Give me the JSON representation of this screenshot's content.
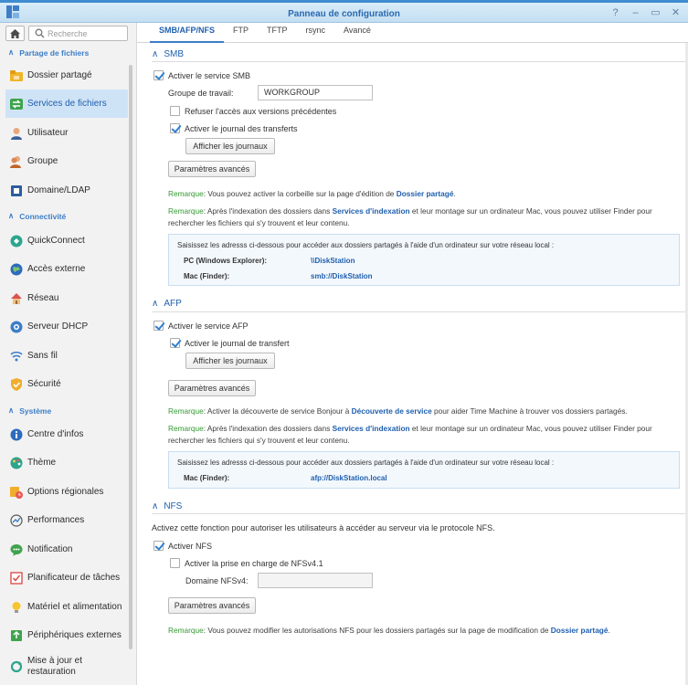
{
  "window": {
    "title": "Panneau de configuration",
    "controls": [
      "?",
      "–",
      "▭",
      "✕"
    ]
  },
  "sidebar": {
    "search_placeholder": "Recherche",
    "sections": [
      {
        "label": "Partage de fichiers"
      },
      {
        "label": "Connectivité"
      },
      {
        "label": "Système"
      }
    ],
    "items": [
      {
        "label": "Dossier partagé"
      },
      {
        "label": "Services de fichiers"
      },
      {
        "label": "Utilisateur"
      },
      {
        "label": "Groupe"
      },
      {
        "label": "Domaine/LDAP"
      },
      {
        "label": "QuickConnect"
      },
      {
        "label": "Accès externe"
      },
      {
        "label": "Réseau"
      },
      {
        "label": "Serveur DHCP"
      },
      {
        "label": "Sans fil"
      },
      {
        "label": "Sécurité"
      },
      {
        "label": "Centre d'infos"
      },
      {
        "label": "Thème"
      },
      {
        "label": "Options régionales"
      },
      {
        "label": "Performances"
      },
      {
        "label": "Notification"
      },
      {
        "label": "Planificateur de tâches"
      },
      {
        "label": "Matériel et alimentation"
      },
      {
        "label": "Périphériques externes"
      },
      {
        "label": "Mise à jour et",
        "label2": "restauration"
      }
    ]
  },
  "tabs": [
    "SMB/AFP/NFS",
    "FTP",
    "TFTP",
    "rsync",
    "Avancé"
  ],
  "smb": {
    "title": "SMB",
    "enable": "Activer le service SMB",
    "workgroup_label": "Groupe de travail:",
    "workgroup_value": "WORKGROUP",
    "deny_prev": "Refuser l'accès aux versions précédentes",
    "transfer_log": "Activer le journal des transferts",
    "show_logs": "Afficher les journaux",
    "advanced": "Paramètres avancés",
    "note1": {
      "kw": "Remarque",
      "text": ": Vous pouvez activer la corbeille sur la page d'édition de ",
      "link": "Dossier partagé",
      "end": "."
    },
    "note2": {
      "kw": "Remarque",
      "text": ": Après l'indexation des dossiers dans ",
      "link": "Services d'indexation",
      "end": " et leur montage sur un ordinateur Mac, vous pouvez utiliser Finder pour rechercher les fichiers qui s'y trouvent et leur contenu."
    },
    "info": {
      "intro": "Saisissez les adresss ci-dessous pour accéder aux dossiers partagés à l'aide d'un ordinateur sur votre réseau local :",
      "rows": [
        {
          "key": "PC (Windows Explorer):",
          "value": "\\\\DiskStation"
        },
        {
          "key": "Mac (Finder):",
          "value": "smb://DiskStation"
        }
      ]
    }
  },
  "afp": {
    "title": "AFP",
    "enable": "Activer le service AFP",
    "transfer_log": "Activer le journal de transfert",
    "show_logs": "Afficher les journaux",
    "advanced": "Paramètres avancés",
    "note1": {
      "kw": "Remarque",
      "text": ": Activer la découverte de service Bonjour à ",
      "link": "Découverte de service",
      "end": " pour aider Time Machine à trouver vos dossiers partagés."
    },
    "note2": {
      "kw": "Remarque",
      "text": ": Après l'indexation des dossiers dans ",
      "link": "Services d'indexation",
      "end": " et leur montage sur un ordinateur Mac, vous pouvez utiliser Finder pour rechercher les fichiers qui s'y trouvent et leur contenu."
    },
    "info": {
      "intro": "Saisissez les adresss ci-dessous pour accéder aux dossiers partagés à l'aide d'un ordinateur sur votre réseau local :",
      "rows": [
        {
          "key": "Mac (Finder):",
          "value": "afp://DiskStation.local"
        }
      ]
    }
  },
  "nfs": {
    "title": "NFS",
    "desc": "Activez cette fonction pour autoriser les utilisateurs à accéder au serveur via le protocole NFS.",
    "enable": "Activer NFS",
    "nfsv41": "Activer la prise en charge de NFSv4.1",
    "domain_label": "Domaine NFSv4:",
    "domain_value": "",
    "advanced": "Paramètres avancés",
    "note1": {
      "kw": "Remarque",
      "text": ": Vous pouvez modifier les autorisations NFS pour les dossiers partagés sur la page de modification de ",
      "link": "Dossier partagé",
      "end": "."
    }
  }
}
